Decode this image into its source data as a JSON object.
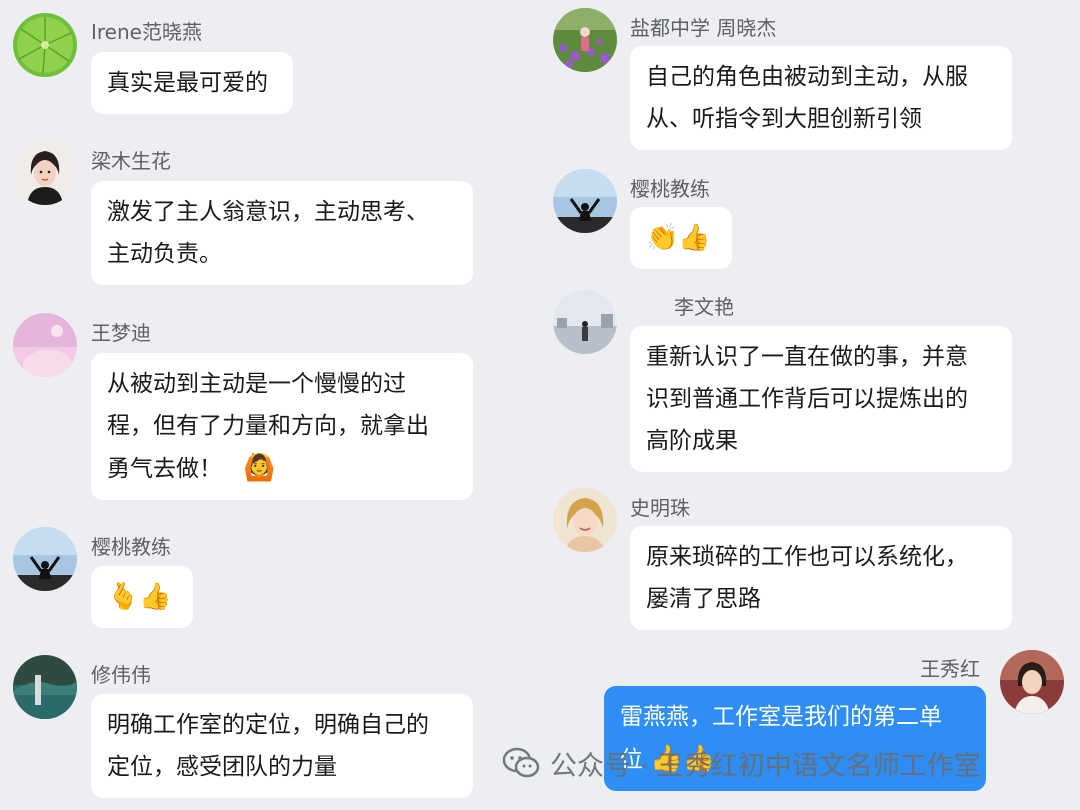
{
  "left_messages": [
    {
      "name": "Irene范晓燕",
      "text": "真实是最可爱的"
    },
    {
      "name": "梁木生花",
      "line1": "激发了主人翁意识，主动思考、",
      "line2": "主动负责。"
    },
    {
      "name": "王梦迪",
      "line1": "从被动到主动是一个慢慢的过",
      "line2": "程，但有了力量和方向，就拿出",
      "line3": "勇气去做！",
      "emoji": "🙆"
    },
    {
      "name": "樱桃教练",
      "emoji": "🫰👍"
    },
    {
      "name": "修伟伟",
      "line1": "明确工作室的定位，明确自己的",
      "line2": "定位，感受团队的力量"
    }
  ],
  "right_messages": [
    {
      "name": "盐都中学  周晓杰",
      "line1": "自己的角色由被动到主动，从服",
      "line2": "从、听指令到大胆创新引领"
    },
    {
      "name": "樱桃教练",
      "emoji": "👏👍"
    },
    {
      "name": "李文艳",
      "line1": "重新认识了一直在做的事，并意",
      "line2": "识到普通工作背后可以提炼出的",
      "line3": "高阶成果"
    },
    {
      "name": "史明珠",
      "line1": "原来琐碎的工作也可以系统化，",
      "line2": "屡清了思路"
    },
    {
      "name": "王秀红",
      "line1": "雷燕燕，工作室是我们的第二单",
      "line2": "位",
      "emoji": "👍👍"
    }
  ],
  "watermark": {
    "text": "公众号 · 王秀红初中语文名师工作室"
  },
  "colors": {
    "background": "#eceef2",
    "bubble": "#ffffff",
    "own_bubble": "#2f8ef3"
  }
}
